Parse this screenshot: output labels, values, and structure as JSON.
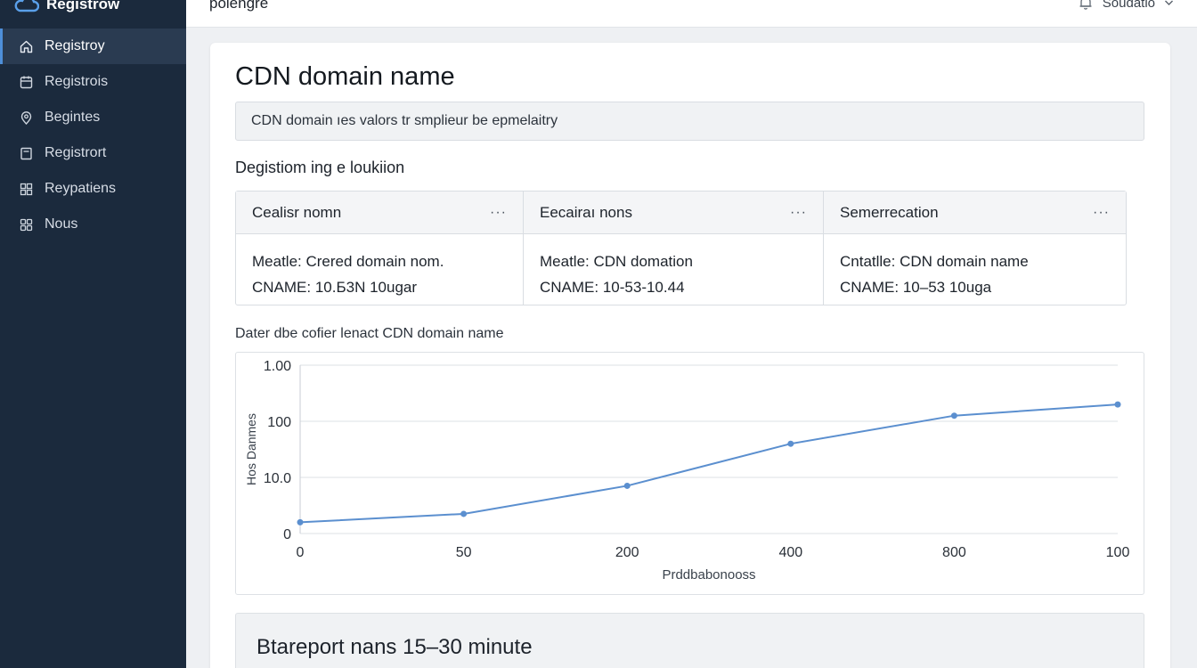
{
  "app": {
    "brand": "Registrow",
    "page_heading": "polengre",
    "user_name": "Soudatio"
  },
  "sidebar": {
    "items": [
      {
        "label": "Registroy",
        "icon": "home-icon",
        "active": true
      },
      {
        "label": "Registrois",
        "icon": "calendar-icon",
        "active": false
      },
      {
        "label": "Begintes",
        "icon": "location-icon",
        "active": false
      },
      {
        "label": "Registrort",
        "icon": "document-icon",
        "active": false
      },
      {
        "label": "Reypatiens",
        "icon": "grid-icon",
        "active": false
      },
      {
        "label": "Nous",
        "icon": "apps-icon",
        "active": false
      }
    ]
  },
  "main": {
    "title": "CDN domain name",
    "info_text": "CDN domain ıes valors tr smplieur be epmelaitry",
    "section_label": "Degistiom ing e loukiion",
    "records": [
      {
        "header": "Cealisr nomn",
        "line1": "Meatle: Crered domain nom.",
        "line2": "CNAME: 10.Б3N 10ugar"
      },
      {
        "header": "Eecairaı nons",
        "line1": "Meatle: CDN domation",
        "line2": "CNAME: 10-53-10.44"
      },
      {
        "header": "Semerrecation",
        "line1": "Cntatlle: CDN domain name",
        "line2": "CNAME: 10–53 10uga"
      }
    ],
    "more_label": "···",
    "chart_title": "Dater dbe cofier lenact CDN domain name",
    "eta_text": "Btareport nans 15–30 minute"
  },
  "colors": {
    "sidebar_bg": "#1b2a3d",
    "accent": "#4e8fd9",
    "series_line": "#5b8fcf"
  },
  "chart_data": {
    "type": "line",
    "xlabel": "Prddbabonooss",
    "ylabel": "Hos Danmes",
    "x_tick_labels": [
      "0",
      "50",
      "200",
      "400",
      "800",
      "100"
    ],
    "y_tick_labels": [
      "0",
      "10.0",
      "100",
      "1.00"
    ],
    "series": [
      {
        "values": [
          0.2,
          0.35,
          0.85,
          1.6,
          2.1,
          2.3
        ]
      }
    ],
    "ylim": [
      0,
      3
    ],
    "grid": true
  }
}
